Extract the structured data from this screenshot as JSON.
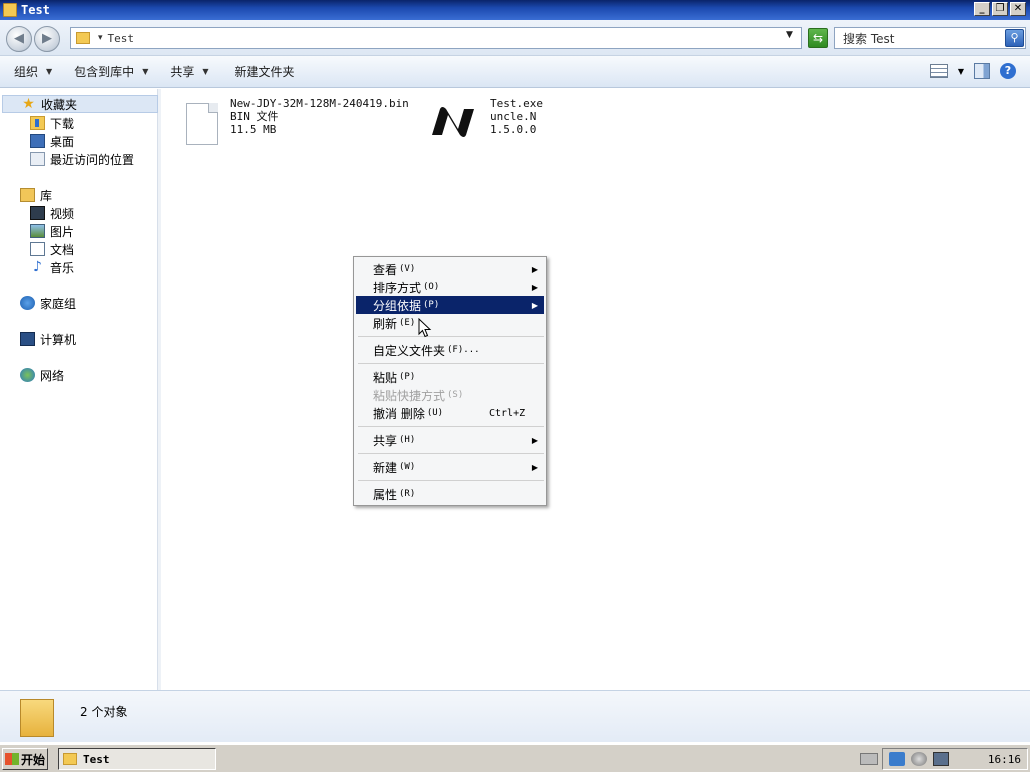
{
  "window": {
    "title": "Test",
    "buttons": {
      "minimize": "_",
      "restore": "❐",
      "close": "✕"
    }
  },
  "address": {
    "path": "Test",
    "search_placeholder": "搜索 Test"
  },
  "toolbar": {
    "organize": "组织",
    "include_in_library": "包含到库中",
    "share": "共享",
    "new_folder": "新建文件夹"
  },
  "sidebar": {
    "favorites": "收藏夹",
    "downloads": "下载",
    "desktop": "桌面",
    "recent": "最近访问的位置",
    "libraries": "库",
    "videos": "视频",
    "pictures": "图片",
    "documents": "文档",
    "music": "音乐",
    "homegroup": "家庭组",
    "computer": "计算机",
    "network": "网络"
  },
  "files": [
    {
      "name": "New-JDY-32M-128M-240419.bin",
      "type": "BIN 文件",
      "size": "11.5 MB",
      "icon": "bin-file-icon"
    },
    {
      "name": "Test.exe",
      "type": "uncle.N",
      "size": "1.5.0.0",
      "icon": "exe-app-icon"
    }
  ],
  "context_menu": {
    "view": {
      "label": "查看",
      "key": "(V)"
    },
    "sort_by": {
      "label": "排序方式",
      "key": "(O)"
    },
    "group_by": {
      "label": "分组依据",
      "key": "(P)"
    },
    "refresh": {
      "label": "刷新",
      "key": "(E)"
    },
    "customize": {
      "label": "自定义文件夹",
      "key": "(F)..."
    },
    "paste": {
      "label": "粘贴",
      "key": "(P)"
    },
    "paste_shortcut": {
      "label": "粘贴快捷方式",
      "key": "(S)"
    },
    "undo_delete": {
      "label": "撤消 删除",
      "key": "(U)",
      "shortcut": "Ctrl+Z"
    },
    "share_with": {
      "label": "共享",
      "key": "(H)"
    },
    "new": {
      "label": "新建",
      "key": "(W)"
    },
    "properties": {
      "label": "属性",
      "key": "(R)"
    }
  },
  "details": {
    "count_text": "2 个对象"
  },
  "taskbar": {
    "start_label": "开始",
    "task_title": "Test",
    "clock": "16:16"
  },
  "colors": {
    "highlight": "#0a246a",
    "titlebar": "#1c4ab0",
    "folder": "#f3c954"
  }
}
